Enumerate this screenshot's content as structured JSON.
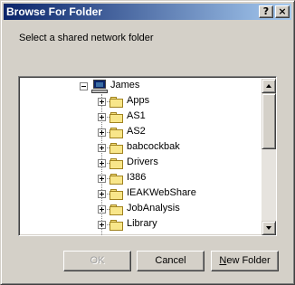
{
  "window": {
    "title": "Browse For Folder",
    "help_label": "?",
    "close_label": "×"
  },
  "prompt": "Select a shared network folder",
  "tree": {
    "root": {
      "label": "James",
      "icon": "computer-icon",
      "expanded": true
    },
    "items": [
      {
        "label": "Apps",
        "icon": "folder-icon"
      },
      {
        "label": "AS1",
        "icon": "folder-icon"
      },
      {
        "label": "AS2",
        "icon": "folder-icon"
      },
      {
        "label": "babcockbak",
        "icon": "folder-icon"
      },
      {
        "label": "Drivers",
        "icon": "folder-icon"
      },
      {
        "label": "I386",
        "icon": "folder-icon"
      },
      {
        "label": "IEAKWebShare",
        "icon": "folder-icon"
      },
      {
        "label": "JobAnalysis",
        "icon": "folder-icon"
      },
      {
        "label": "Library",
        "icon": "folder-icon"
      }
    ]
  },
  "buttons": {
    "ok": "OK",
    "cancel": "Cancel",
    "new_folder_first": "N",
    "new_folder_rest": "ew Folder"
  }
}
